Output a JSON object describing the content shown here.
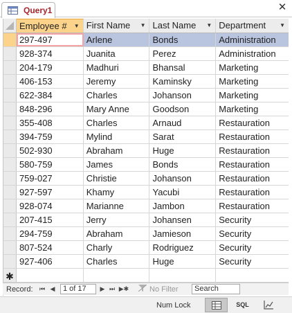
{
  "tab": {
    "icon": "table-query-icon",
    "label": "Query1",
    "close_glyph": "✕"
  },
  "columns": {
    "employee_num": "Employee #",
    "first_name": "First Name",
    "last_name": "Last Name",
    "department": "Department",
    "dropdown_glyph": "▼"
  },
  "rows": [
    {
      "emp": "297-497",
      "first": "Arlene",
      "last": "Bonds",
      "dept": "Administration"
    },
    {
      "emp": "928-374",
      "first": "Juanita",
      "last": "Perez",
      "dept": "Administration"
    },
    {
      "emp": "204-179",
      "first": "Madhuri",
      "last": "Bhansal",
      "dept": "Marketing"
    },
    {
      "emp": "406-153",
      "first": "Jeremy",
      "last": "Kaminsky",
      "dept": "Marketing"
    },
    {
      "emp": "622-384",
      "first": "Charles",
      "last": "Johanson",
      "dept": "Marketing"
    },
    {
      "emp": "848-296",
      "first": "Mary Anne",
      "last": "Goodson",
      "dept": "Marketing"
    },
    {
      "emp": "355-408",
      "first": "Charles",
      "last": "Arnaud",
      "dept": "Restauration"
    },
    {
      "emp": "394-759",
      "first": "Mylind",
      "last": "Sarat",
      "dept": "Restauration"
    },
    {
      "emp": "502-930",
      "first": "Abraham",
      "last": "Huge",
      "dept": "Restauration"
    },
    {
      "emp": "580-759",
      "first": "James",
      "last": "Bonds",
      "dept": "Restauration"
    },
    {
      "emp": "759-027",
      "first": "Christie",
      "last": "Johanson",
      "dept": "Restauration"
    },
    {
      "emp": "927-597",
      "first": "Khamy",
      "last": "Yacubi",
      "dept": "Restauration"
    },
    {
      "emp": "928-074",
      "first": "Marianne",
      "last": "Jambon",
      "dept": "Restauration"
    },
    {
      "emp": "207-415",
      "first": "Jerry",
      "last": "Johansen",
      "dept": "Security"
    },
    {
      "emp": "294-759",
      "first": "Abraham",
      "last": "Jamieson",
      "dept": "Security"
    },
    {
      "emp": "807-524",
      "first": "Charly",
      "last": "Rodriguez",
      "dept": "Security"
    },
    {
      "emp": "927-406",
      "first": "Charles",
      "last": "Huge",
      "dept": "Security"
    }
  ],
  "new_record_glyph": "✱",
  "navigation": {
    "record_label": "Record:",
    "first_glyph": "⏮",
    "prev_glyph": "◀",
    "position": "1 of 17",
    "next_glyph": "▶",
    "last_glyph": "⏭",
    "new_glyph": "▶✱",
    "filter_label": "No Filter",
    "search_label": "Search"
  },
  "status": {
    "num_lock": "Num Lock",
    "sql_label": "SQL"
  },
  "colors": {
    "accent": "#a4262c",
    "active_header": "#fbd38a",
    "selected_row": "#b9c4df"
  }
}
